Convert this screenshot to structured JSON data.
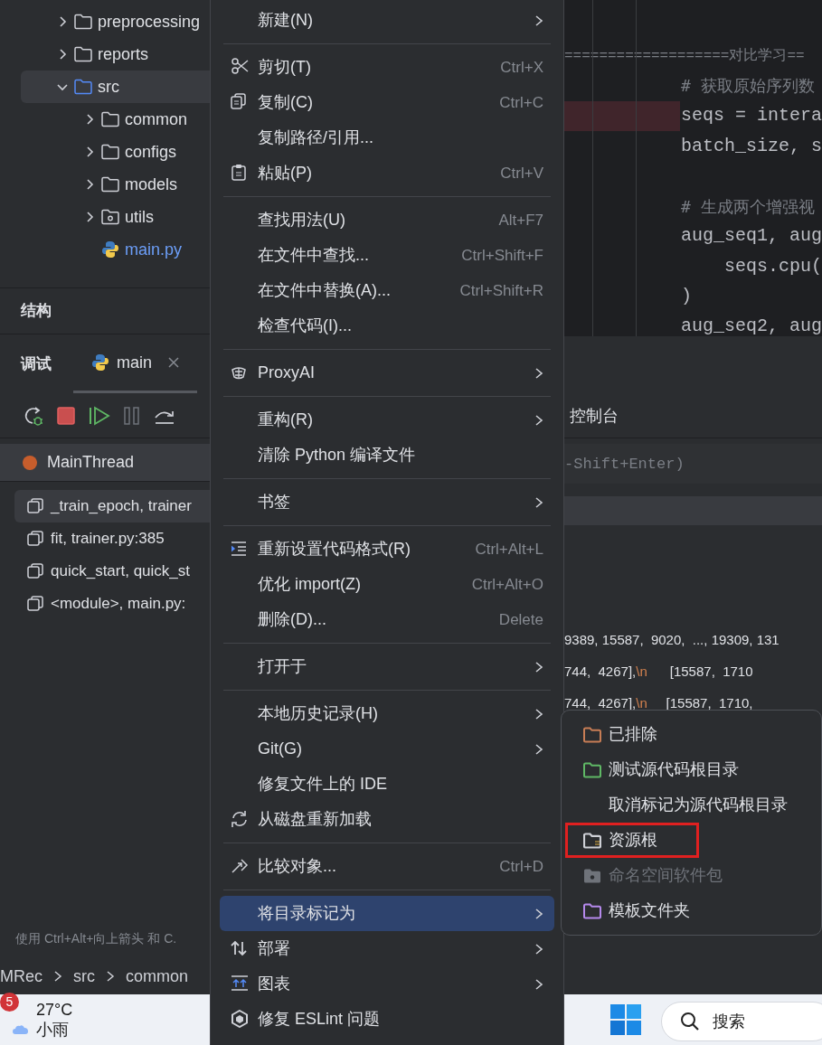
{
  "project_tree": [
    {
      "label": "preprocessing",
      "kind": "folder",
      "color": "#ced0d6",
      "expanded": false,
      "selected": false
    },
    {
      "label": "reports",
      "kind": "folder",
      "color": "#ced0d6",
      "expanded": false,
      "selected": false
    },
    {
      "label": "src",
      "kind": "folder",
      "color": "#548af7",
      "expanded": true,
      "selected": true,
      "children": [
        {
          "label": "common",
          "kind": "folder",
          "color": "#ced0d6",
          "expanded": false,
          "selected": false
        },
        {
          "label": "configs",
          "kind": "folder",
          "color": "#ced0d6",
          "expanded": false,
          "selected": false
        },
        {
          "label": "models",
          "kind": "folder",
          "color": "#ced0d6",
          "expanded": false,
          "selected": false
        },
        {
          "label": "utils",
          "kind": "package",
          "color": "#ced0d6",
          "expanded": false,
          "selected": false
        },
        {
          "label": "main.py",
          "kind": "python",
          "color": "#6c9ef8",
          "selected": false
        }
      ]
    }
  ],
  "structure_panel": {
    "title": "结构"
  },
  "debug_panel": {
    "title": "调试",
    "tabs": [
      {
        "label": "main",
        "selected": true
      }
    ],
    "thread": "MainThread",
    "frames": [
      {
        "label": "_train_epoch, trainer",
        "selected": true
      },
      {
        "label": "fit, trainer.py:385",
        "selected": false
      },
      {
        "label": "quick_start, quick_st",
        "selected": false
      },
      {
        "label": "<module>, main.py:",
        "selected": false
      }
    ],
    "hint": "使用 Ctrl+Alt+向上箭头 和 C."
  },
  "editor": {
    "lines": [
      {
        "kind": "separator",
        "text": "===================对比学习=="
      },
      {
        "kind": "comment",
        "text": "# 获取原始序列数"
      },
      {
        "kind": "code",
        "text": "seqs = intera",
        "breakpoint": true
      },
      {
        "kind": "code",
        "text": "batch_size, s",
        "breakpoint": false
      },
      {
        "kind": "blank"
      },
      {
        "kind": "comment",
        "text": "# 生成两个增强视"
      },
      {
        "kind": "code",
        "text": "aug_seq1, aug",
        "breakpoint": false
      },
      {
        "kind": "code",
        "text": "    seqs.cpu(",
        "breakpoint": false
      },
      {
        "kind": "code",
        "text": ")",
        "breakpoint": false
      },
      {
        "kind": "code",
        "text": "aug_seq2, aug",
        "breakpoint": false
      }
    ]
  },
  "console": {
    "tab": "控制台",
    "placeholder": "-Shift+Enter)",
    "output": [
      [
        {
          "text": "9389, 15587,  9020,  ..., 19309, 131"
        }
      ],
      [
        {
          "text": "744,  4267],"
        },
        {
          "text": "\\n",
          "kind": "escape"
        },
        {
          "text": "      [15587,  1710"
        }
      ],
      [
        {
          "text": "744,  4267],"
        },
        {
          "text": "\\n",
          "kind": "escape"
        },
        {
          "text": "     [15587,  1710,"
        }
      ]
    ]
  },
  "context_menu": {
    "items": [
      {
        "kind": "plain",
        "label": "新建(N)",
        "submenu": true,
        "selected": false
      },
      {
        "kind": "separator"
      },
      {
        "kind": "cut",
        "label": "剪切(T)",
        "shortcut": "Ctrl+X",
        "selected": false
      },
      {
        "kind": "copy",
        "label": "复制(C)",
        "shortcut": "Ctrl+C",
        "selected": false
      },
      {
        "kind": "plain",
        "label": "复制路径/引用...",
        "selected": false
      },
      {
        "kind": "paste",
        "label": "粘贴(P)",
        "shortcut": "Ctrl+V",
        "selected": false
      },
      {
        "kind": "separator"
      },
      {
        "kind": "plain",
        "label": "查找用法(U)",
        "shortcut": "Alt+F7",
        "selected": false
      },
      {
        "kind": "plain",
        "label": "在文件中查找...",
        "shortcut": "Ctrl+Shift+F",
        "selected": false
      },
      {
        "kind": "plain",
        "label": "在文件中替换(A)...",
        "shortcut": "Ctrl+Shift+R",
        "selected": false
      },
      {
        "kind": "plain",
        "label": "检查代码(I)...",
        "selected": false
      },
      {
        "kind": "separator"
      },
      {
        "kind": "plugin",
        "label": "ProxyAI",
        "submenu": true,
        "selected": false
      },
      {
        "kind": "separator"
      },
      {
        "kind": "plain",
        "label": "重构(R)",
        "submenu": true,
        "selected": false
      },
      {
        "kind": "plain",
        "label": "清除 Python 编译文件",
        "submenu": false,
        "selected": false
      },
      {
        "kind": "separator"
      },
      {
        "kind": "plain",
        "label": "书签",
        "submenu": true,
        "selected": false
      },
      {
        "kind": "separator"
      },
      {
        "kind": "reformat",
        "label": "重新设置代码格式(R)",
        "shortcut": "Ctrl+Alt+L",
        "selected": false
      },
      {
        "kind": "plain",
        "label": "优化 import(Z)",
        "shortcut": "Ctrl+Alt+O",
        "selected": false
      },
      {
        "kind": "plain",
        "label": "删除(D)...",
        "shortcut": "Delete",
        "selected": false
      },
      {
        "kind": "separator"
      },
      {
        "kind": "plain",
        "label": "打开于",
        "submenu": true,
        "selected": false
      },
      {
        "kind": "separator"
      },
      {
        "kind": "plain",
        "label": "本地历史记录(H)",
        "submenu": true,
        "selected": false
      },
      {
        "kind": "plain",
        "label": "Git(G)",
        "submenu": true,
        "selected": false
      },
      {
        "kind": "plain",
        "label": "修复文件上的 IDE",
        "submenu": false,
        "selected": false
      },
      {
        "kind": "reload",
        "label": "从磁盘重新加载",
        "submenu": false,
        "selected": false
      },
      {
        "kind": "separator"
      },
      {
        "kind": "compare",
        "label": "比较对象...",
        "shortcut": "Ctrl+D",
        "selected": false
      },
      {
        "kind": "separator"
      },
      {
        "kind": "plain",
        "label": "将目录标记为",
        "submenu": true,
        "selected": true
      },
      {
        "kind": "deploy",
        "label": "部署",
        "submenu": true,
        "selected": false
      },
      {
        "kind": "diagram",
        "label": "图表",
        "submenu": true,
        "selected": false
      },
      {
        "kind": "lint",
        "label": "修复 ESLint 问题",
        "submenu": false,
        "selected": false
      }
    ]
  },
  "submenu": {
    "items": [
      {
        "label": "已排除",
        "kind": "folder",
        "color": "#c77d55",
        "disabled": false,
        "highlighted": false
      },
      {
        "label": "测试源代码根目录",
        "kind": "folder",
        "color": "#5fb865",
        "disabled": false,
        "highlighted": false
      },
      {
        "label": "取消标记为源代码根目录",
        "kind": "plain",
        "disabled": false,
        "highlighted": false
      },
      {
        "label": "资源根",
        "kind": "resource",
        "color": "#ced0d6",
        "disabled": false,
        "highlighted": true
      },
      {
        "label": "命名空间软件包",
        "kind": "package",
        "color": "#6f737a",
        "disabled": true,
        "highlighted": false
      },
      {
        "label": "模板文件夹",
        "kind": "folder",
        "color": "#b589ec",
        "disabled": false,
        "highlighted": false
      }
    ]
  },
  "breadcrumb": [
    "MRec",
    "src",
    "common"
  ],
  "taskbar": {
    "weather_badge": "5",
    "temperature": "27°C",
    "weather": "小雨",
    "search": "搜索"
  }
}
